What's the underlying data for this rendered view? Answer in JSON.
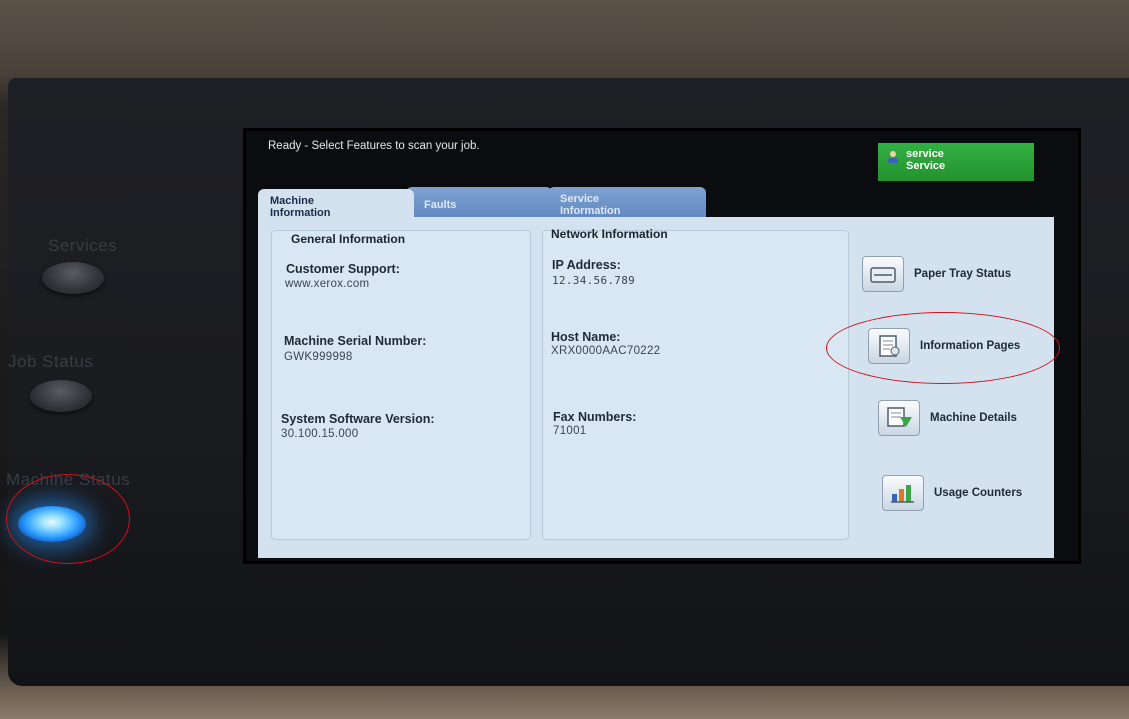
{
  "device": {
    "hw_buttons": {
      "services": "Services",
      "job_status": "Job Status",
      "machine_status": "Machine Status"
    }
  },
  "screen": {
    "status_message": "Ready -  Select Features to scan your job.",
    "user_badge": {
      "line1": "service",
      "line2": "Service"
    },
    "tabs": [
      {
        "label_line1": "Machine",
        "label_line2": "Information",
        "active": true
      },
      {
        "label_line1": "Faults",
        "label_line2": "",
        "active": false
      },
      {
        "label_line1": "Service",
        "label_line2": "Information",
        "active": false
      }
    ],
    "general_info": {
      "title": "General Information",
      "fields": [
        {
          "label": "Customer Support:",
          "value": "www.xerox.com"
        },
        {
          "label": "Machine Serial Number:",
          "value": "GWK999998"
        },
        {
          "label": "System Software Version:",
          "value": "30.100.15.000"
        }
      ]
    },
    "network_info": {
      "title": "Network Information",
      "fields": [
        {
          "label": "IP Address:",
          "value": "12.34.56.789"
        },
        {
          "label": "Host Name:",
          "value": "XRX0000AAC70222"
        },
        {
          "label": "Fax Numbers:",
          "value": "71001"
        }
      ]
    },
    "side_buttons": [
      {
        "label": "Paper Tray Status",
        "icon": "paper-tray-icon"
      },
      {
        "label": "Information Pages",
        "icon": "information-pages-icon"
      },
      {
        "label": "Machine Details",
        "icon": "machine-details-icon"
      },
      {
        "label": "Usage Counters",
        "icon": "usage-counters-icon"
      }
    ]
  },
  "colors": {
    "panel": "#d3e2ee",
    "badge_green": "#2aa137",
    "annotation_red": "#d0101a",
    "lit_button_blue": "#2a9bff"
  }
}
